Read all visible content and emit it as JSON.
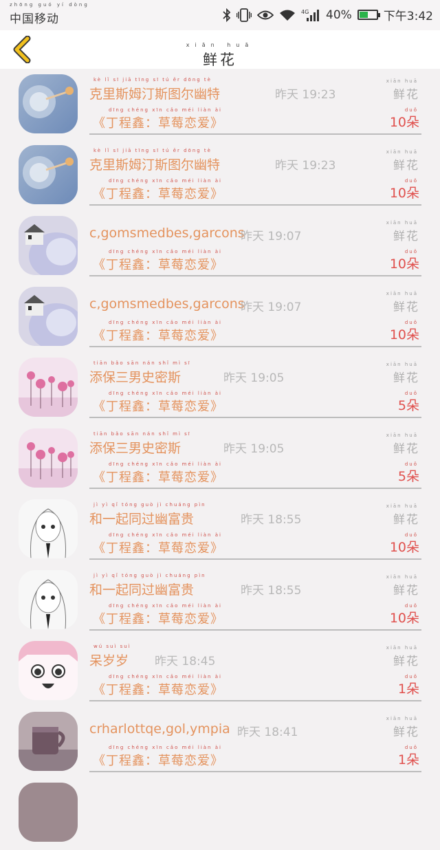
{
  "status_bar": {
    "carrier": "中国移动",
    "carrier_pinyin": "zhōng guó yí dòng",
    "network": "4G",
    "battery": "40%",
    "time": "下午3:42",
    "icons": [
      "bluetooth-icon",
      "vibrate-icon",
      "eye-icon",
      "wifi-icon",
      "signal-icon",
      "battery-icon"
    ]
  },
  "header": {
    "title": "鲜花",
    "title_pinyin": "xiān huā",
    "back_icon": "chevron-left-icon",
    "accent_color": "#f2c11e"
  },
  "right_label": "鲜花",
  "right_label_pinyin": "xiān huā",
  "count_pinyin": "duǒ",
  "gift_pinyin": "dīng chéng xīn    cǎo méi liàn ài",
  "items": [
    {
      "name": "克里斯姆汀斯图尔幽特",
      "name_pinyin": "kè lǐ sī jiā tīng sī tú ěr dōng tè",
      "time": "昨天 19:23",
      "gift": "《丁程鑫：草莓恋爱》",
      "count": "10朵",
      "avatar": "dandelion-photo"
    },
    {
      "name": "克里斯姆汀斯图尔幽特",
      "name_pinyin": "kè lǐ sī jiā tīng sī tú ěr dōng tè",
      "time": "昨天 19:23",
      "gift": "《丁程鑫：草莓恋爱》",
      "count": "10朵",
      "avatar": "dandelion-photo"
    },
    {
      "name": "c,gomsmedbes,garcons",
      "name_pinyin": "",
      "time": "昨天 19:07",
      "gift": "《丁程鑫：草莓恋爱》",
      "count": "10朵",
      "avatar": "lavender-house-photo"
    },
    {
      "name": "c,gomsmedbes,garcons",
      "name_pinyin": "",
      "time": "昨天 19:07",
      "gift": "《丁程鑫：草莓恋爱》",
      "count": "10朵",
      "avatar": "lavender-house-photo"
    },
    {
      "name": "添保三男史密斯",
      "name_pinyin": "tiān bǎo sān nán shǐ mì sī",
      "time": "昨天 19:05",
      "gift": "《丁程鑫：草莓恋爱》",
      "count": "5朵",
      "avatar": "pink-flowers-photo"
    },
    {
      "name": "添保三男史密斯",
      "name_pinyin": "tiān bǎo sān nán shǐ mì sī",
      "time": "昨天 19:05",
      "gift": "《丁程鑫：草莓恋爱》",
      "count": "5朵",
      "avatar": "pink-flowers-photo"
    },
    {
      "name": "和一起同过幽富贵",
      "name_pinyin": "jì yì qǐ tóng guò jì chuáng pìn",
      "time": "昨天 18:55",
      "gift": "《丁程鑫：草莓恋爱》",
      "count": "10朵",
      "avatar": "manga-girl-sketch"
    },
    {
      "name": "和一起同过幽富贵",
      "name_pinyin": "jì yì qǐ tóng guò jì chuáng pìn",
      "time": "昨天 18:55",
      "gift": "《丁程鑫：草莓恋爱》",
      "count": "10朵",
      "avatar": "manga-girl-sketch"
    },
    {
      "name": "呆岁岁",
      "name_pinyin": "wú suì suì",
      "time": "昨天 18:45",
      "gift": "《丁程鑫：草莓恋爱》",
      "count": "1朵",
      "avatar": "manga-girl-pink"
    },
    {
      "name": "crharlottqe,gol,ympia",
      "name_pinyin": "",
      "time": "昨天 18:41",
      "gift": "《丁程鑫：草莓恋爱》",
      "count": "1朵",
      "avatar": "coffee-cup-photo"
    }
  ]
}
